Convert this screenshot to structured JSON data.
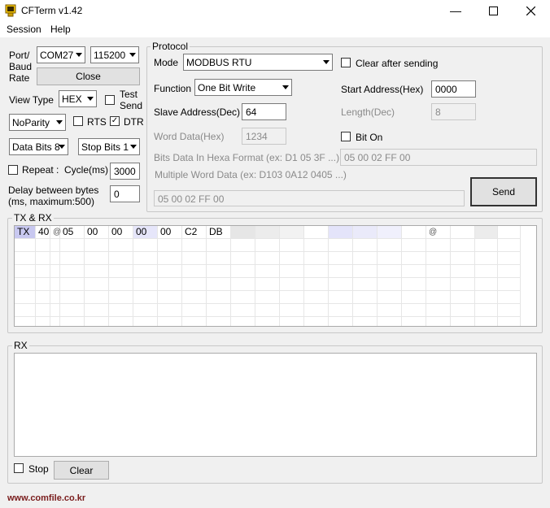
{
  "window": {
    "title": "CFTerm v1.42"
  },
  "menu": [
    "Session",
    "Help"
  ],
  "port": {
    "label": [
      "Port/",
      "Baud",
      "Rate"
    ],
    "port_value": "COM27",
    "baud_value": "115200",
    "close_label": "Close"
  },
  "view_type": {
    "label": "View Type",
    "value": "HEX"
  },
  "test_send": {
    "label": [
      "Test",
      "Send"
    ],
    "checked": false
  },
  "parity": {
    "value": "NoParity"
  },
  "rts": {
    "label": "RTS",
    "checked": false
  },
  "dtr": {
    "label": "DTR",
    "checked": true
  },
  "data_bits": {
    "value": "Data Bits 8"
  },
  "stop_bits": {
    "value": "Stop Bits 1"
  },
  "repeat": {
    "label": "Repeat :",
    "checked": false,
    "cycle_label": "Cycle(ms)",
    "cycle_value": "3000"
  },
  "delay": {
    "label": [
      "Delay between bytes",
      "(ms, maximum:500)"
    ],
    "value": "0"
  },
  "protocol": {
    "group_label": "Protocol",
    "mode_label": "Mode",
    "mode_value": "MODBUS RTU",
    "clear_after_sending": {
      "label": "Clear after sending",
      "checked": false
    },
    "function_label": "Function",
    "function_value": "One Bit Write",
    "start_address_label": "Start Address(Hex)",
    "start_address_value": "0000",
    "slave_address_label": "Slave Address(Dec)",
    "slave_address_value": "64",
    "length_label": "Length(Dec)",
    "length_value": "8",
    "word_data_label": "Word Data(Hex)",
    "word_data_value": "1234",
    "bit_on": {
      "label": "Bit On",
      "checked": false
    },
    "bits_data_label": "Bits Data In Hexa Format (ex: D1 05 3F ...)",
    "bits_data_value": "05 00 02 FF 00",
    "multi_word_label": "Multiple Word Data (ex: D103 0A12 0405 ...)",
    "output_value": "05 00 02 FF 00",
    "send_label": "Send"
  },
  "txrx": {
    "group_label": "TX & RX",
    "row": [
      "TX",
      "40",
      "@",
      "05",
      "00",
      "00",
      "00",
      "00",
      "C2",
      "DB",
      "",
      "",
      "",
      "",
      "",
      "",
      "",
      "",
      "@",
      "",
      "",
      ""
    ]
  },
  "rx": {
    "group_label": "RX",
    "stop": {
      "label": "Stop",
      "checked": false
    },
    "clear_label": "Clear"
  },
  "footer": {
    "url": "www.comfile.co.kr"
  },
  "colors": {
    "highlight": "#c8c8f0",
    "footer_text": "#7a1d1d"
  }
}
